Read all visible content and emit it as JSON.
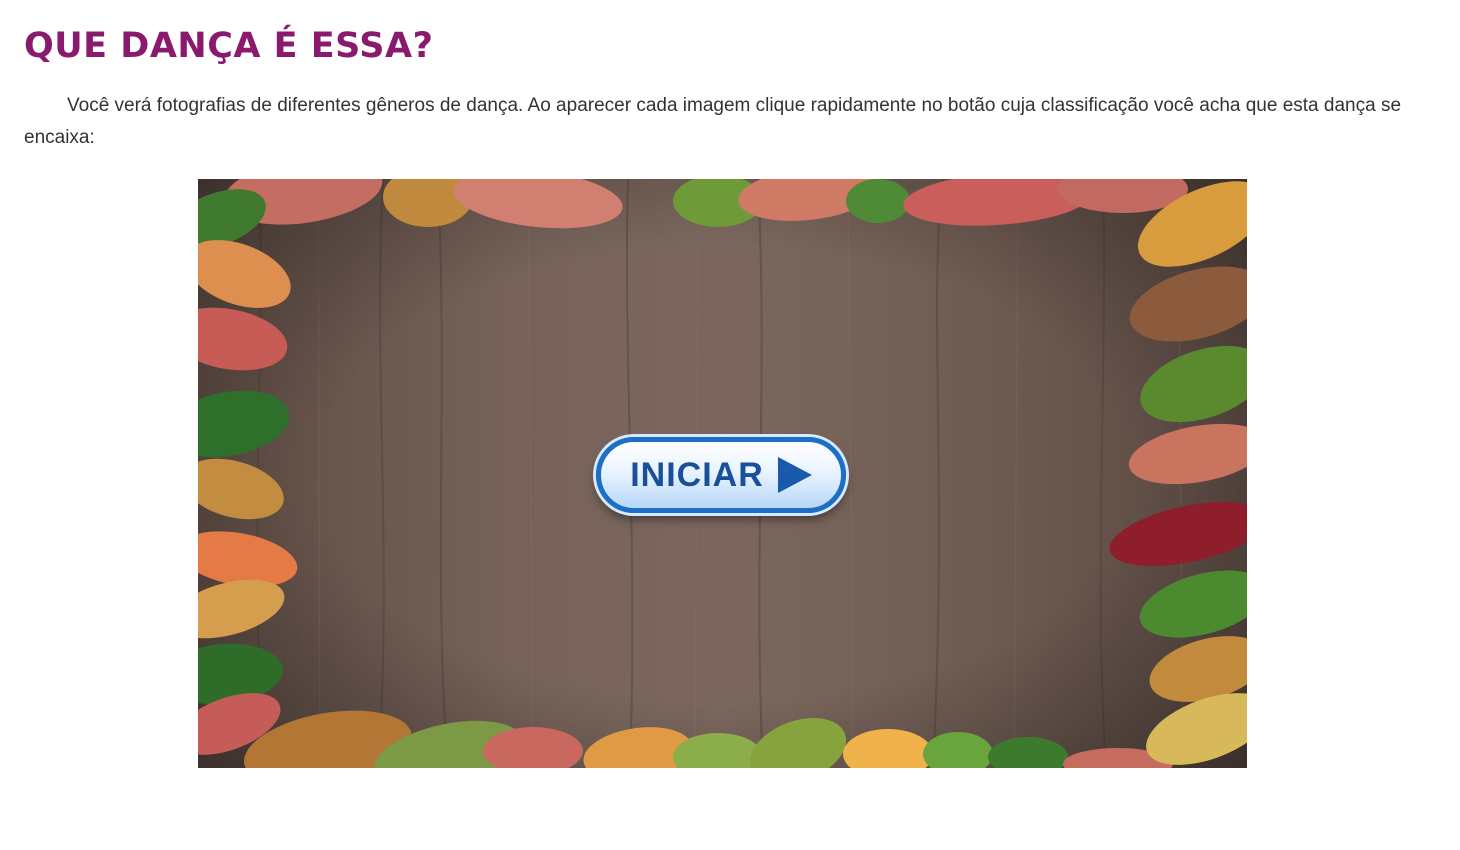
{
  "header": {
    "title": "QUE DANÇA É ESSA?"
  },
  "intro": {
    "text": "Você verá fotografias de diferentes gêneros de dança. Ao aparecer cada imagem clique rapidamente no botão cuja classificação você acha que esta dança se encaixa:"
  },
  "game": {
    "start_label": "INICIAR",
    "start_icon": "play-triangle-icon",
    "background": "wood-table-with-autumn-leaves",
    "colors": {
      "title": "#8a1a6e",
      "button_border": "#1c6fc4",
      "button_text": "#1a4f9a",
      "wood": "#6c5a52"
    }
  }
}
